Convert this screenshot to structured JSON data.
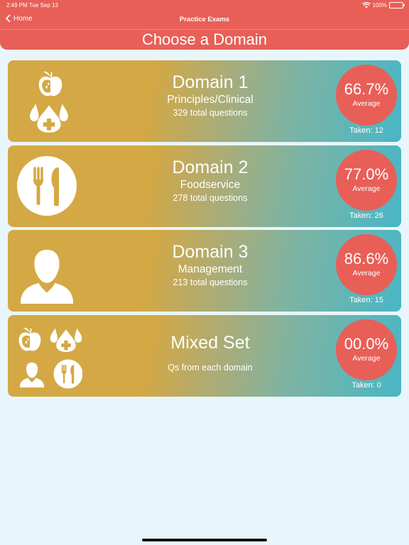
{
  "status": {
    "time": "2:49 PM",
    "date": "Tue Sep 13",
    "battery": "100%",
    "battery_level": 1.0
  },
  "nav": {
    "back_label": "Home",
    "title": "Practice Exams"
  },
  "page_title": "Choose a Domain",
  "cards": [
    {
      "title": "Domain 1",
      "subtitle": "Principles/Clinical",
      "count": "329 total questions",
      "score": "66.7%",
      "score_label": "Average",
      "taken": "Taken: 12",
      "icon": "apple-and-drops-icon"
    },
    {
      "title": "Domain 2",
      "subtitle": "Foodservice",
      "count": "278 total questions",
      "score": "77.0%",
      "score_label": "Average",
      "taken": "Taken: 26",
      "icon": "fork-knife-icon"
    },
    {
      "title": "Domain 3",
      "subtitle": "Management",
      "count": "213 total questions",
      "score": "86.6%",
      "score_label": "Average",
      "taken": "Taken: 15",
      "icon": "person-icon"
    },
    {
      "title": "Mixed Set",
      "subtitle": "",
      "count": "Qs from each domain",
      "score": "00.0%",
      "score_label": "Average",
      "taken": "Taken: 0",
      "icon": "mixed-domains-icon"
    }
  ],
  "colors": {
    "header": "#e85f58",
    "background": "#e8f6fb",
    "card_gold": "#d4a844",
    "card_teal": "#48b6c6",
    "score_circle": "#e85f58"
  }
}
